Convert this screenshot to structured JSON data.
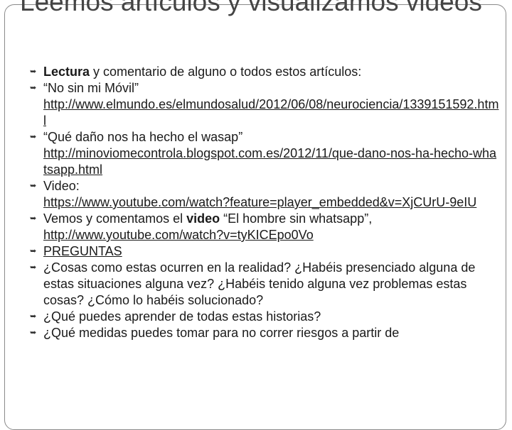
{
  "slide": {
    "title": "Leemos artículos y visualizamos videos",
    "bullet_icon": "leaf-arrow-bullet-icon"
  },
  "items": [
    {
      "bold": "Lectura",
      "text": " y comentario de alguno o todos estos artículos:"
    },
    {
      "text": "“No sin mi Móvil”",
      "link": "http://www.elmundo.es/elmundosalud/2012/06/08/neurociencia/1339151592.html"
    },
    {
      "text": " “Qué daño nos ha hecho el wasap”",
      "link": "http://minoviomecontrola.blogspot.com.es/2012/11/que-dano-nos-ha-hecho-whatsapp.html"
    },
    {
      "text": "Video:",
      "link": "https://www.youtube.com/watch?feature=player_embedded&v=XjCUrU-9eIU"
    },
    {
      "pre": "Vemos  y comentamos  el ",
      "bold": "video",
      "post": " “El hombre  sin whatsapp”,",
      "link": "http://www.youtube.com/watch?v=tyKICEpo0Vo"
    },
    {
      "text": "PREGUNTAS"
    },
    {
      "text": "¿Cosas como estas ocurren en la realidad? ¿Habéis presenciado alguna de estas situaciones alguna vez? ¿Habéis tenido alguna vez problemas estas cosas? ¿Cómo lo habéis solucionado?"
    },
    {
      "text": "¿Qué puedes aprender de todas estas historias?"
    },
    {
      "text": "¿Qué medidas puedes tomar para no correr riesgos a partir de"
    }
  ]
}
